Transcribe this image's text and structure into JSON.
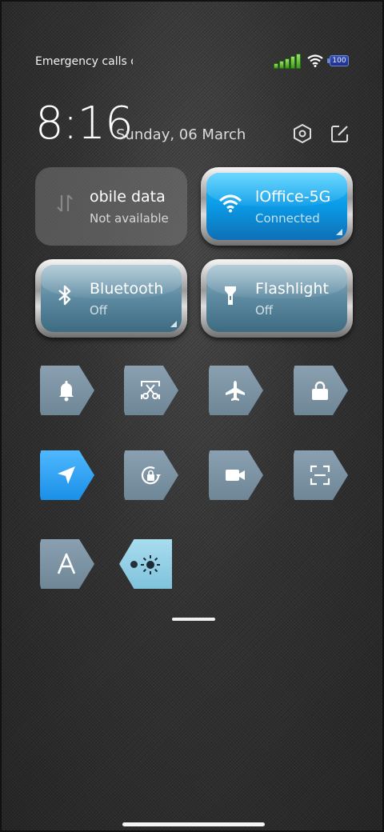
{
  "status_bar": {
    "carrier_text": "Emergency calls o",
    "battery_level": "100",
    "signal_icon": "signal-bars-icon",
    "wifi_icon": "wifi-icon"
  },
  "header": {
    "time": "8:16",
    "date": "Sunday, 06 March"
  },
  "tiles": {
    "mobile_data": {
      "title": "obile data",
      "subtitle": "Not available",
      "icon": "mobile-data-arrows-icon"
    },
    "wifi": {
      "title": "lOffice-5G",
      "subtitle": "Connected",
      "icon": "wifi-icon"
    },
    "bluetooth": {
      "title": "Bluetooth",
      "subtitle": "Off",
      "icon": "bluetooth-icon"
    },
    "flashlight": {
      "title": "Flashlight",
      "subtitle": "Off",
      "icon": "flashlight-icon"
    }
  },
  "toggles": [
    {
      "icon": "bell-icon",
      "active": false
    },
    {
      "icon": "screenshot-scissors-icon",
      "active": false
    },
    {
      "icon": "airplane-icon",
      "active": false
    },
    {
      "icon": "lock-icon",
      "active": false
    },
    {
      "icon": "location-arrow-icon",
      "active": true
    },
    {
      "icon": "rotation-lock-icon",
      "active": false
    },
    {
      "icon": "video-camera-icon",
      "active": false
    },
    {
      "icon": "scan-frame-icon",
      "active": false
    },
    {
      "icon": "font-a-icon",
      "active": false
    },
    {
      "icon": "brightness-sun-icon",
      "active": false
    }
  ],
  "colors": {
    "accent_blue": "#1a8fe6",
    "toggle_grey": "#7b92a2",
    "tag_blue": "#8fcbe2"
  }
}
